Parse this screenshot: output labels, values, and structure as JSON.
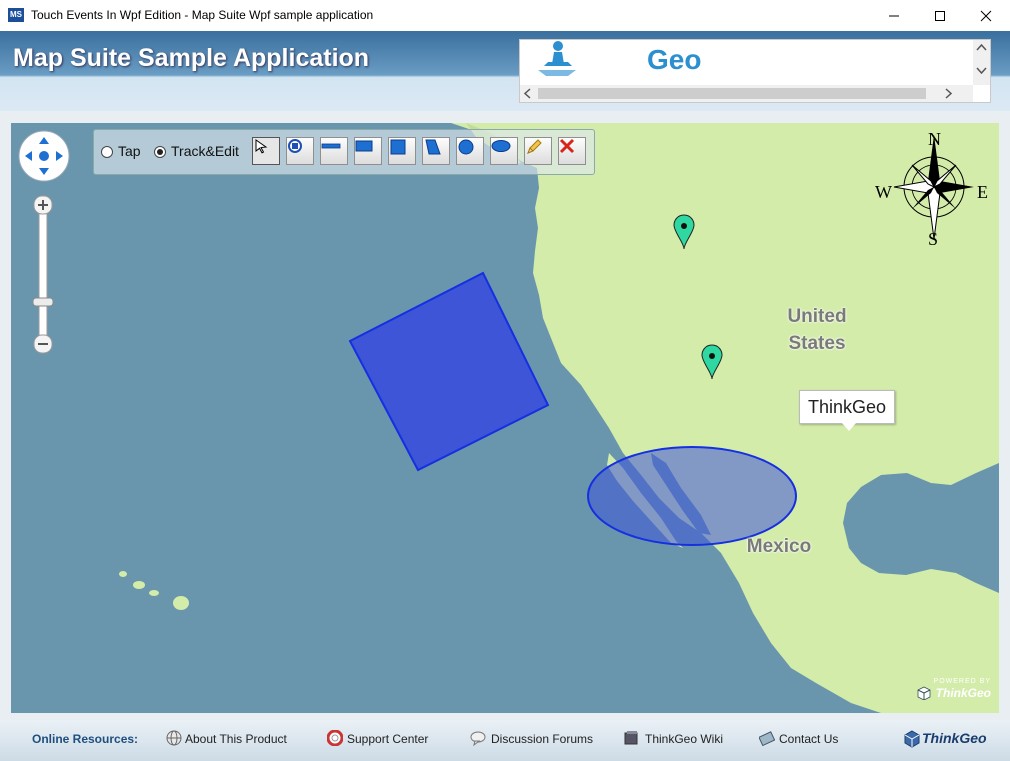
{
  "window": {
    "title": "Touch Events In Wpf Edition - Map Suite Wpf sample application",
    "app_icon": "MS"
  },
  "header": {
    "title": "Map Suite Sample Application",
    "banner_text": "Geo"
  },
  "toolbar": {
    "mode_tap": "Tap",
    "mode_track": "Track&Edit",
    "selected_mode": "Track&Edit"
  },
  "map": {
    "labels": {
      "us": "United States",
      "mexico": "Mexico"
    },
    "popup_text": "ThinkGeo",
    "compass": {
      "n": "N",
      "s": "S",
      "e": "E",
      "w": "W"
    },
    "powered_top": "POWERED BY",
    "powered_brand": "ThinkGeo"
  },
  "footer": {
    "online_resources": "Online Resources:",
    "links": [
      "About This Product",
      "Support Center",
      "Discussion Forums",
      "ThinkGeo Wiki",
      "Contact Us"
    ],
    "logo": "ThinkGeo"
  },
  "colors": {
    "ocean": "#6a96ad",
    "land": "#d3ecaa",
    "shape_fill": "#3e55d8",
    "shape_stroke": "#1530e0",
    "marker": "#2ed8a0"
  }
}
